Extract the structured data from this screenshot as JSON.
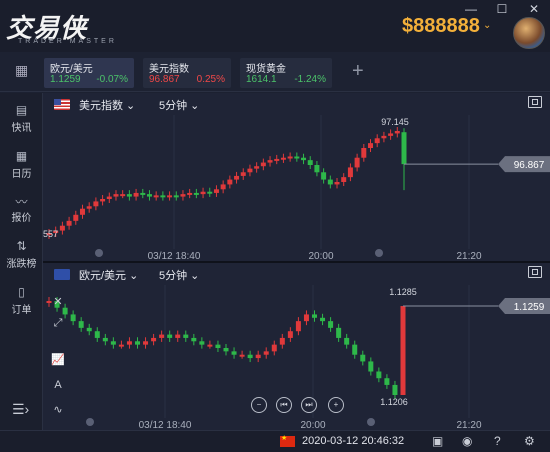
{
  "app": {
    "logo": "交易侠",
    "logo_sub": "TRADER MASTER",
    "balance": "$888888",
    "win_min": "—",
    "win_max": "☐",
    "win_close": "✕"
  },
  "tabs": [
    {
      "name": "欧元/美元",
      "price": "1.1259",
      "change": "-0.07%",
      "price_color": "#4cc36a",
      "change_color": "#4cc36a"
    },
    {
      "name": "美元指数",
      "price": "96.867",
      "change": "0.25%",
      "price_color": "#f04848",
      "change_color": "#f04848"
    },
    {
      "name": "现货黄金",
      "price": "1614.1",
      "change": "-1.24%",
      "price_color": "#4cc36a",
      "change_color": "#4cc36a"
    }
  ],
  "sidebar": [
    {
      "label": "快讯",
      "icon": "news-icon",
      "glyph": "▤"
    },
    {
      "label": "日历",
      "icon": "calendar-icon",
      "glyph": "▦"
    },
    {
      "label": "报价",
      "icon": "quote-chart-icon",
      "glyph": "〰"
    },
    {
      "label": "涨跌榜",
      "icon": "sort-arrows-icon",
      "glyph": "⇅"
    },
    {
      "label": "订单",
      "icon": "order-icon",
      "glyph": "▯"
    }
  ],
  "chart_top": {
    "symbol": "美元指数",
    "timeframe": "5分钟",
    "high_label": "97.145",
    "low_label": "557",
    "last_price": "96.867",
    "time_labels": [
      "03/12 18:40",
      "20:00",
      "21:20"
    ],
    "colors": {
      "up": "#e0393b",
      "down": "#2eb84a"
    }
  },
  "chart_bottom": {
    "symbol": "欧元/美元",
    "timeframe": "5分钟",
    "high_label": "1.1285",
    "low_label": "1.1206",
    "last_price": "1.1259",
    "time_labels": [
      "03/12 18:40",
      "20:00",
      "21:20"
    ]
  },
  "chart_data": [
    {
      "type": "candlestick",
      "title": "美元指数",
      "x": [
        "03/12 18:40",
        "20:00",
        "21:20"
      ],
      "close": [
        96.3,
        96.32,
        96.36,
        96.4,
        96.45,
        96.5,
        96.52,
        96.56,
        96.58,
        96.6,
        96.62,
        96.62,
        96.6,
        96.63,
        96.62,
        96.6,
        96.61,
        96.6,
        96.61,
        96.6,
        96.62,
        96.63,
        96.62,
        96.64,
        96.63,
        96.66,
        96.7,
        96.74,
        96.77,
        96.8,
        96.83,
        96.85,
        96.88,
        96.9,
        96.91,
        96.92,
        96.93,
        96.92,
        96.9,
        96.86,
        96.8,
        96.74,
        96.7,
        96.72,
        96.76,
        96.84,
        96.92,
        97.0,
        97.04,
        97.08,
        97.1,
        97.12,
        97.14,
        96.867
      ],
      "y_ticks": [
        "97.145",
        "96.867"
      ]
    },
    {
      "type": "candlestick",
      "title": "欧元/美元",
      "x": [
        "03/12 18:40",
        "20:00",
        "21:20"
      ],
      "close": [
        1.1262,
        1.1258,
        1.1254,
        1.125,
        1.1246,
        1.1244,
        1.124,
        1.1238,
        1.1236,
        1.1236,
        1.1238,
        1.1236,
        1.1238,
        1.124,
        1.1242,
        1.124,
        1.1242,
        1.124,
        1.1238,
        1.1236,
        1.1236,
        1.1234,
        1.1232,
        1.123,
        1.123,
        1.1228,
        1.123,
        1.1232,
        1.1236,
        1.124,
        1.1244,
        1.125,
        1.1254,
        1.1252,
        1.125,
        1.1246,
        1.124,
        1.1236,
        1.123,
        1.1226,
        1.122,
        1.1216,
        1.1212,
        1.1206,
        1.1259
      ],
      "y_ticks": [
        "1.1285",
        "1.1259",
        "1.1206"
      ]
    }
  ],
  "status": {
    "datetime": "2020-03-12 20:46:32"
  }
}
